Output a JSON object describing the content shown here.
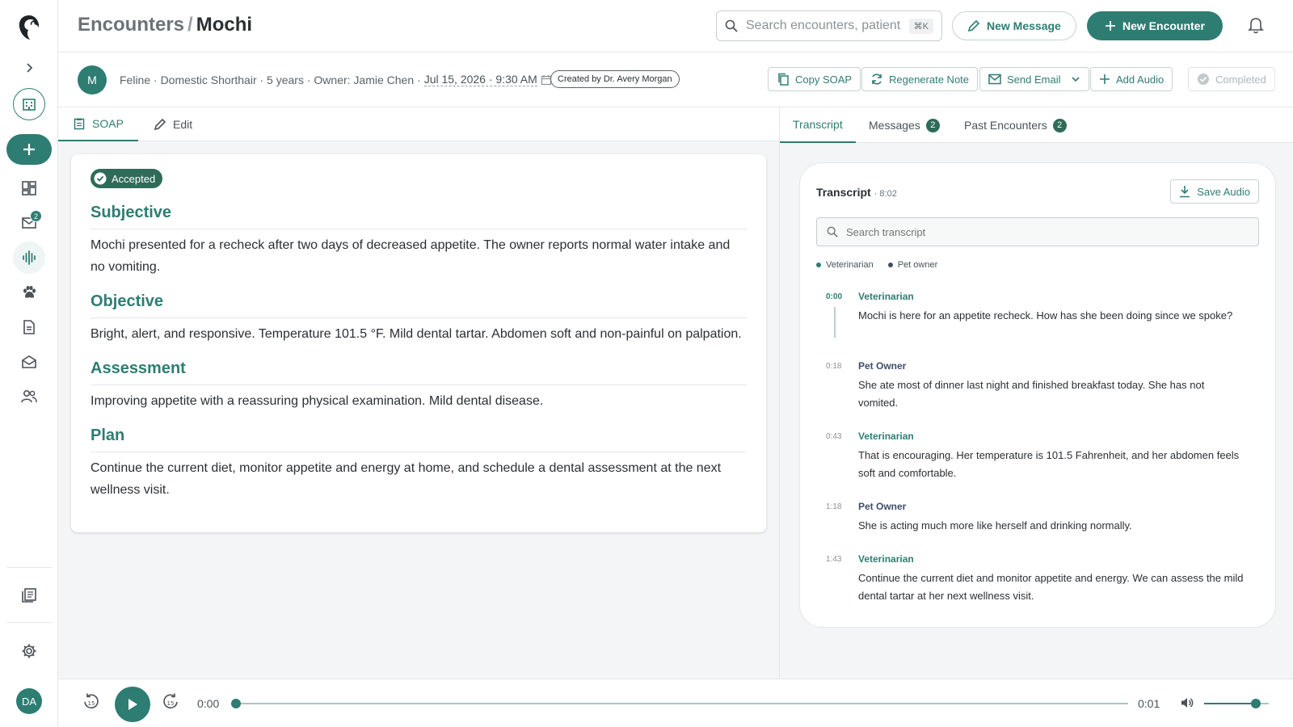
{
  "colors": {
    "accent": "#2e7d72",
    "veterinarian": "#2e7d72",
    "pet_owner": "#3e4e6a"
  },
  "sidebar": {
    "inbox_badge": "2",
    "avatar_initials": "DA",
    "icons": [
      "logo-icon",
      "chevron-right-icon",
      "clinic-icon",
      "plus-icon",
      "dashboard-icon",
      "inbox-icon",
      "audio-wave-icon",
      "paw-icon",
      "document-icon",
      "mail-open-icon",
      "users-icon",
      "notes-icon",
      "gear-icon"
    ]
  },
  "header": {
    "breadcrumb_parent": "Encounters",
    "breadcrumb_sep": "/",
    "title": "Mochi",
    "search_placeholder": "Search encounters, patients",
    "search_shortcut": "⌘K",
    "new_message": "New Message",
    "new_encounter": "New Encounter"
  },
  "encounter": {
    "avatar_letter": "M",
    "details": "Feline · Domestic Shorthair · 5 years · Owner: Jamie Chen ·",
    "date": "Jul 15, 2026 · 9:30 AM",
    "created_by": "Created by Dr. Avery Morgan",
    "actions": {
      "copy_soap": "Copy SOAP",
      "regenerate": "Regenerate Note",
      "send_email": "Send Email",
      "add_audio": "Add Audio",
      "completed": "Completed"
    }
  },
  "left_tabs": {
    "soap": "SOAP",
    "edit": "Edit"
  },
  "soap": {
    "status": "Accepted",
    "sections": [
      {
        "title": "Subjective",
        "body": "Mochi presented for a recheck after two days of decreased appetite. The owner reports normal water intake and no vomiting."
      },
      {
        "title": "Objective",
        "body": "Bright, alert, and responsive. Temperature 101.5 °F. Mild dental tartar. Abdomen soft and non-painful on palpation."
      },
      {
        "title": "Assessment",
        "body": "Improving appetite with a reassuring physical examination. Mild dental disease."
      },
      {
        "title": "Plan",
        "body": "Continue the current diet, monitor appetite and energy at home, and schedule a dental assessment at the next wellness visit."
      }
    ]
  },
  "right_tabs": {
    "transcript": "Transcript",
    "messages": "Messages",
    "messages_count": "2",
    "past": "Past Encounters",
    "past_count": "2"
  },
  "transcript": {
    "title": "Transcript",
    "duration": "· 8:02",
    "save_audio": "Save Audio",
    "search_placeholder": "Search transcript",
    "legend_vet": "Veterinarian",
    "legend_owner": "Pet owner",
    "utterances": [
      {
        "time": "0:00",
        "speaker": "Veterinarian",
        "text": "Mochi is here for an appetite recheck. How has she been doing since we spoke?"
      },
      {
        "time": "0:18",
        "speaker": "Pet Owner",
        "text": "She ate most of dinner last night and finished breakfast today. She has not vomited."
      },
      {
        "time": "0:43",
        "speaker": "Veterinarian",
        "text": "That is encouraging. Her temperature is 101.5 Fahrenheit, and her abdomen feels soft and comfortable."
      },
      {
        "time": "1:18",
        "speaker": "Pet Owner",
        "text": "She is acting much more like herself and drinking normally."
      },
      {
        "time": "1:43",
        "speaker": "Veterinarian",
        "text": "Continue the current diet and monitor appetite and energy. We can assess the mild dental tartar at her next wellness visit."
      }
    ]
  },
  "player": {
    "current": "0:00",
    "total": "0:01",
    "progress_fraction": 0,
    "volume_fraction": 0.8
  }
}
